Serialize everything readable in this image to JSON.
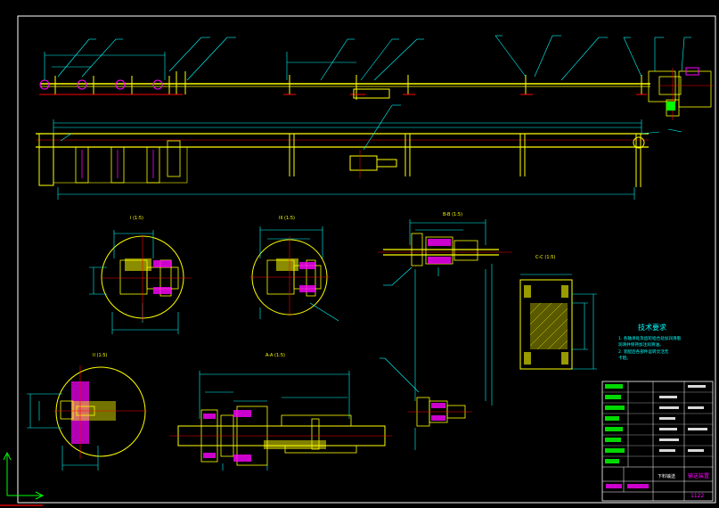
{
  "drawing": {
    "section_labels": {
      "detail_i": "I (1:5)",
      "detail_iii": "III (1:5)",
      "section_bb": "B-B (1:5)",
      "section_cc": "C-C (1:5)",
      "detail_ii": "II (1:5)",
      "section_aa": "A-A (1:5)"
    },
    "tech_requirements": {
      "title": "技术要求",
      "line1": "1. 各轴承处及齿轮啮合处加润滑脂",
      "line2": "   润滑并保持加注润滑油。",
      "line3": "2. 装配后各部件运转灵活无",
      "line4": "   卡阻。"
    },
    "title_block": {
      "drawing_name": "输送装置",
      "part_number": "1122",
      "sub_name": "下料输送"
    },
    "colors": {
      "frame": "#ffffff",
      "part": "#ffff00",
      "dimension": "#00ffff",
      "center": "#ff0000",
      "hatch": "#00ff00",
      "accent": "#ff00ff"
    }
  }
}
